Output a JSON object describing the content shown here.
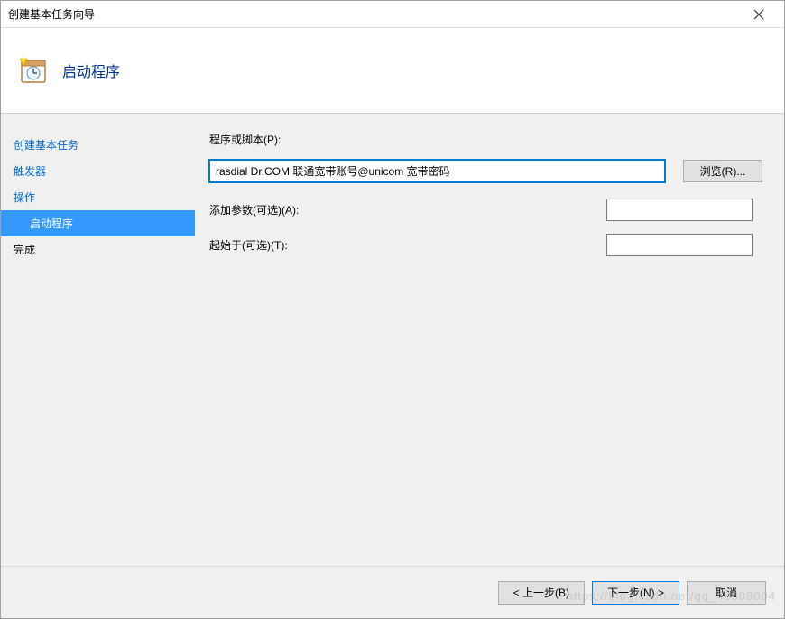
{
  "window": {
    "title": "创建基本任务向导"
  },
  "header": {
    "title": "启动程序"
  },
  "sidebar": {
    "items": [
      {
        "label": "创建基本任务",
        "link": true,
        "indent": false,
        "selected": false
      },
      {
        "label": "触发器",
        "link": true,
        "indent": false,
        "selected": false
      },
      {
        "label": "操作",
        "link": true,
        "indent": false,
        "selected": false
      },
      {
        "label": "启动程序",
        "link": false,
        "indent": true,
        "selected": true
      },
      {
        "label": "完成",
        "link": false,
        "indent": false,
        "selected": false
      }
    ]
  },
  "form": {
    "program_label": "程序或脚本(P):",
    "program_value": "rasdial Dr.COM 联通宽带账号@unicom 宽带密码",
    "browse_label": "浏览(R)...",
    "args_label": "添加参数(可选)(A):",
    "args_value": "",
    "startin_label": "起始于(可选)(T):",
    "startin_value": ""
  },
  "footer": {
    "back": "< 上一步(B)",
    "next": "下一步(N) >",
    "cancel": "取消"
  },
  "watermark": "https://blog.csdn.net/qq_43808004"
}
